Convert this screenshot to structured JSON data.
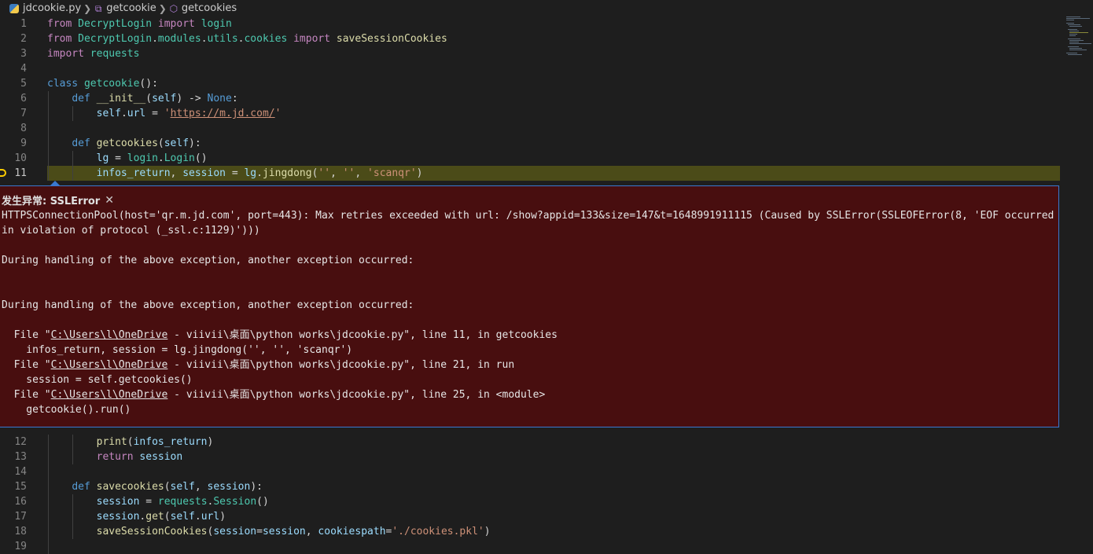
{
  "breadcrumb": {
    "file": "jdcookie.py",
    "class_name": "getcookie",
    "method_name": "getcookies"
  },
  "icons": {
    "file": "python-file-icon",
    "class": "class-symbol-icon",
    "method": "method-symbol-icon",
    "close": "close-icon",
    "breakpoint": "breakpoint-arrow-icon"
  },
  "colors": {
    "editor_bg": "#1e1e1e",
    "exception_bg": "#480e0f",
    "exception_border": "#3a79d0",
    "current_line_bg": "#4b4b18",
    "breakpoint": "#ffcc00"
  },
  "code_lines_top": [
    {
      "n": "1",
      "t": [
        [
          "kw-flow",
          "from"
        ],
        [
          "plain",
          " "
        ],
        [
          "cls",
          "DecryptLogin"
        ],
        [
          "plain",
          " "
        ],
        [
          "kw-flow",
          "import"
        ],
        [
          "plain",
          " "
        ],
        [
          "cls",
          "login"
        ]
      ]
    },
    {
      "n": "2",
      "t": [
        [
          "kw-flow",
          "from"
        ],
        [
          "plain",
          " "
        ],
        [
          "cls",
          "DecryptLogin"
        ],
        [
          "plain",
          "."
        ],
        [
          "cls",
          "modules"
        ],
        [
          "plain",
          "."
        ],
        [
          "cls",
          "utils"
        ],
        [
          "plain",
          "."
        ],
        [
          "cls",
          "cookies"
        ],
        [
          "plain",
          " "
        ],
        [
          "kw-flow",
          "import"
        ],
        [
          "plain",
          " "
        ],
        [
          "fn",
          "saveSessionCookies"
        ]
      ]
    },
    {
      "n": "3",
      "t": [
        [
          "kw-flow",
          "import"
        ],
        [
          "plain",
          " "
        ],
        [
          "cls",
          "requests"
        ]
      ]
    },
    {
      "n": "4",
      "t": []
    },
    {
      "n": "5",
      "t": [
        [
          "kw",
          "class"
        ],
        [
          "plain",
          " "
        ],
        [
          "cls",
          "getcookie"
        ],
        [
          "plain",
          "():"
        ]
      ]
    },
    {
      "n": "6",
      "t": [
        [
          "plain",
          "    "
        ],
        [
          "kw",
          "def"
        ],
        [
          "plain",
          " "
        ],
        [
          "fn",
          "__init__"
        ],
        [
          "plain",
          "("
        ],
        [
          "var",
          "self"
        ],
        [
          "plain",
          ") -> "
        ],
        [
          "kw",
          "None"
        ],
        [
          "plain",
          ":"
        ]
      ]
    },
    {
      "n": "7",
      "t": [
        [
          "plain",
          "        "
        ],
        [
          "var",
          "self"
        ],
        [
          "plain",
          "."
        ],
        [
          "var",
          "url"
        ],
        [
          "plain",
          " = "
        ],
        [
          "str",
          "'"
        ],
        [
          "str url",
          "https://m.jd.com/"
        ],
        [
          "str",
          "'"
        ]
      ]
    },
    {
      "n": "8",
      "t": []
    },
    {
      "n": "9",
      "t": [
        [
          "plain",
          "    "
        ],
        [
          "kw",
          "def"
        ],
        [
          "plain",
          " "
        ],
        [
          "fn",
          "getcookies"
        ],
        [
          "plain",
          "("
        ],
        [
          "var",
          "self"
        ],
        [
          "plain",
          "):"
        ]
      ]
    },
    {
      "n": "10",
      "t": [
        [
          "plain",
          "        "
        ],
        [
          "var",
          "lg"
        ],
        [
          "plain",
          " = "
        ],
        [
          "cls",
          "login"
        ],
        [
          "plain",
          "."
        ],
        [
          "cls",
          "Login"
        ],
        [
          "plain",
          "()"
        ]
      ]
    },
    {
      "n": "11",
      "t": [
        [
          "plain",
          "        "
        ],
        [
          "var",
          "infos_return"
        ],
        [
          "plain",
          ", "
        ],
        [
          "var",
          "session"
        ],
        [
          "plain",
          " = "
        ],
        [
          "var",
          "lg"
        ],
        [
          "plain",
          "."
        ],
        [
          "fn",
          "jingdong"
        ],
        [
          "plain",
          "("
        ],
        [
          "str",
          "''"
        ],
        [
          "plain",
          ", "
        ],
        [
          "str",
          "''"
        ],
        [
          "plain",
          ", "
        ],
        [
          "str",
          "'scanqr'"
        ],
        [
          "plain",
          ")"
        ]
      ]
    }
  ],
  "code_lines_bottom": [
    {
      "n": "12",
      "t": [
        [
          "plain",
          "        "
        ],
        [
          "fn",
          "print"
        ],
        [
          "plain",
          "("
        ],
        [
          "var",
          "infos_return"
        ],
        [
          "plain",
          ")"
        ]
      ]
    },
    {
      "n": "13",
      "t": [
        [
          "plain",
          "        "
        ],
        [
          "kw-flow",
          "return"
        ],
        [
          "plain",
          " "
        ],
        [
          "var",
          "session"
        ]
      ]
    },
    {
      "n": "14",
      "t": []
    },
    {
      "n": "15",
      "t": [
        [
          "plain",
          "    "
        ],
        [
          "kw",
          "def"
        ],
        [
          "plain",
          " "
        ],
        [
          "fn",
          "savecookies"
        ],
        [
          "plain",
          "("
        ],
        [
          "var",
          "self"
        ],
        [
          "plain",
          ", "
        ],
        [
          "var",
          "session"
        ],
        [
          "plain",
          "):"
        ]
      ]
    },
    {
      "n": "16",
      "t": [
        [
          "plain",
          "        "
        ],
        [
          "var",
          "session"
        ],
        [
          "plain",
          " = "
        ],
        [
          "cls",
          "requests"
        ],
        [
          "plain",
          "."
        ],
        [
          "cls",
          "Session"
        ],
        [
          "plain",
          "()"
        ]
      ]
    },
    {
      "n": "17",
      "t": [
        [
          "plain",
          "        "
        ],
        [
          "var",
          "session"
        ],
        [
          "plain",
          "."
        ],
        [
          "fn",
          "get"
        ],
        [
          "plain",
          "("
        ],
        [
          "var",
          "self"
        ],
        [
          "plain",
          "."
        ],
        [
          "var",
          "url"
        ],
        [
          "plain",
          ")"
        ]
      ]
    },
    {
      "n": "18",
      "t": [
        [
          "plain",
          "        "
        ],
        [
          "fn",
          "saveSessionCookies"
        ],
        [
          "plain",
          "("
        ],
        [
          "var",
          "session"
        ],
        [
          "plain",
          "="
        ],
        [
          "var",
          "session"
        ],
        [
          "plain",
          ", "
        ],
        [
          "var",
          "cookiespath"
        ],
        [
          "plain",
          "="
        ],
        [
          "str",
          "'./cookies.pkl'"
        ],
        [
          "plain",
          ")"
        ]
      ]
    },
    {
      "n": "19",
      "t": []
    }
  ],
  "exception": {
    "title": "发生异常: SSLError",
    "line1": "HTTPSConnectionPool(host='qr.m.jd.com', port=443): Max retries exceeded with url: /show?appid=133&size=147&t=1648991911115 (Caused by SSLError(SSLEOFError(8, 'EOF occurred",
    "line2": "in violation of protocol (_ssl.c:1129)')))",
    "during1": "During handling of the above exception, another exception occurred:",
    "during2": "During handling of the above exception, another exception occurred:",
    "tb1_prefix": "  File \"",
    "tb1_path": "C:\\Users\\l\\OneDrive",
    "tb1_suffix": " - viivii\\桌面\\python works\\jdcookie.py\", line 11, in getcookies",
    "tb1_code": "    infos_return, session = lg.jingdong('', '', 'scanqr')",
    "tb2_prefix": "  File \"",
    "tb2_path": "C:\\Users\\l\\OneDrive",
    "tb2_suffix": " - viivii\\桌面\\python works\\jdcookie.py\", line 21, in run",
    "tb2_code": "    session = self.getcookies()",
    "tb3_prefix": "  File \"",
    "tb3_path": "C:\\Users\\l\\OneDrive",
    "tb3_suffix": " - viivii\\桌面\\python works\\jdcookie.py\", line 25, in <module>",
    "tb3_code": "    getcookie().run()"
  }
}
